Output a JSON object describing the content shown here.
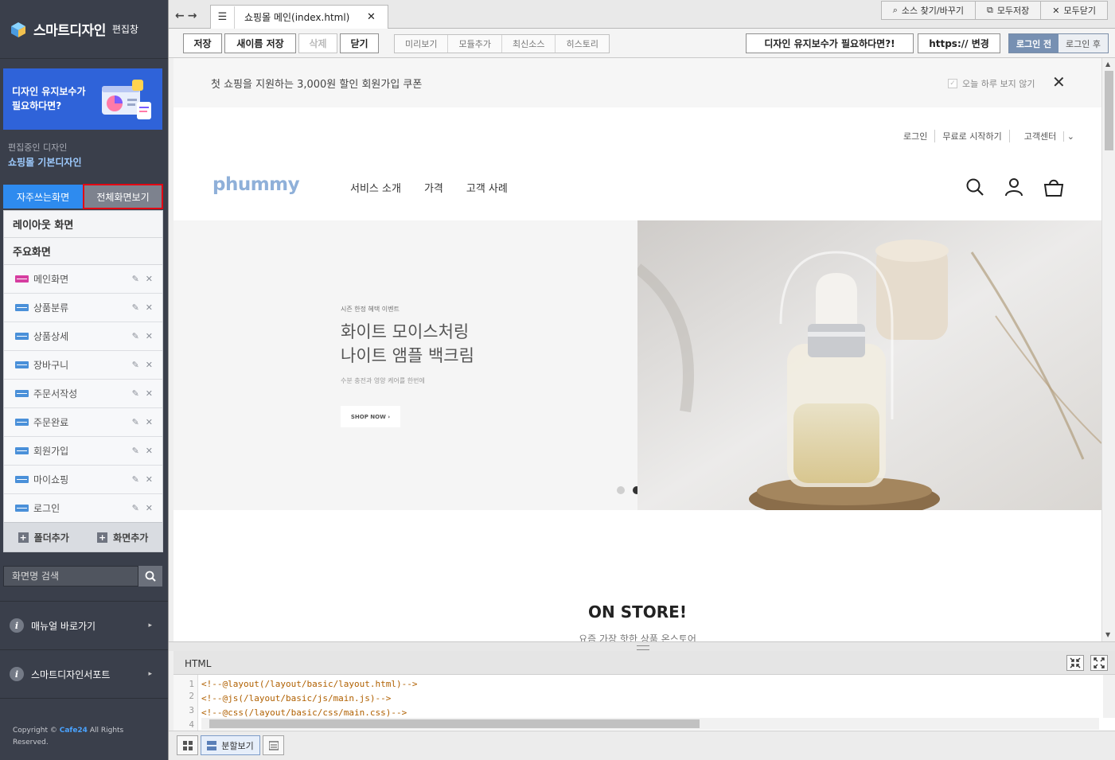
{
  "app": {
    "logo": "스마트디자인",
    "logo_sub": "편집창"
  },
  "sidebar": {
    "banner_line1": "디자인 유지보수가",
    "banner_line2": "필요하다면?",
    "editing_label": "편집중인 디자인",
    "editing_name": "쇼핑몰 기본디자인",
    "tab_frequent": "자주쓰는화면",
    "tab_all": "전체화면보기",
    "group_layout": "레이아웃 화면",
    "group_main": "주요화면",
    "items": [
      {
        "label": "메인화면"
      },
      {
        "label": "상품분류"
      },
      {
        "label": "상품상세"
      },
      {
        "label": "장바구니"
      },
      {
        "label": "주문서작성"
      },
      {
        "label": "주문완료"
      },
      {
        "label": "회원가입"
      },
      {
        "label": "마이쇼핑"
      },
      {
        "label": "로그인"
      }
    ],
    "add_folder": "폴더추가",
    "add_screen": "화면추가",
    "search_placeholder": "화면명 검색",
    "manual_link": "매뉴얼 바로가기",
    "support_link": "스마트디자인서포트",
    "copyright_prefix": "Copyright ©",
    "copyright_brand": "Cafe24",
    "copyright_suffix": "All Rights",
    "copyright_line2": "Reserved."
  },
  "topbar": {
    "tab_title": "쇼핑몰 메인(index.html)",
    "find_replace": "소스 찾기/바꾸기",
    "save_all": "모두저장",
    "close_all": "모두닫기"
  },
  "toolbar": {
    "save": "저장",
    "save_as": "새이름 저장",
    "delete": "삭제",
    "close": "닫기",
    "preview": "미리보기",
    "add_module": "모듈추가",
    "latest_source": "최신소스",
    "history": "히스토리",
    "maintenance": "디자인 유지보수가 필요하다면?!",
    "https_change": "https:// 변경",
    "before_login": "로그인 전",
    "after_login": "로그인 후"
  },
  "preview": {
    "coupon_text": "첫 쇼핑을 지원하는 3,000원 할인 회원가입 쿠폰",
    "coupon_hide": "오늘 하루 보지 않기",
    "util_login": "로그인",
    "util_start": "무료로 시작하기",
    "util_cs": "고객센터",
    "logo": "phummy",
    "nav": [
      "서비스 소개",
      "가격",
      "고객 사례"
    ],
    "hero_tag": "시즌 한정 혜택 이벤트",
    "hero_line1": "화이트 모이스처링",
    "hero_line2": "나이트 앰플 백크림",
    "hero_desc": "수분 충전과 영양 케어를 한번에",
    "hero_btn": "SHOP NOW ›",
    "store_title": "ON STORE!",
    "store_sub": "요즘 가장 핫한 상품 온스토어"
  },
  "code": {
    "title": "HTML",
    "lines": [
      "<!--@layout(/layout/basic/layout.html)-->",
      "<!--@js(/layout/basic/js/main.js)-->",
      "<!--@css(/layout/basic/css/main.css)-->",
      ""
    ],
    "line_numbers": [
      "1",
      "2",
      "3",
      "4"
    ]
  },
  "bottom": {
    "split_view": "분할보기"
  }
}
